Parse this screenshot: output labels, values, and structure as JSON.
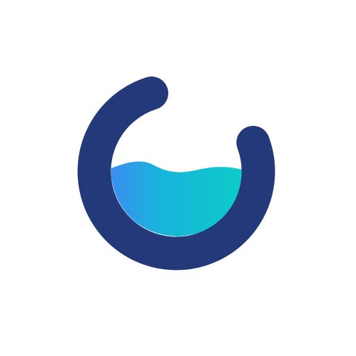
{
  "icon": {
    "name": "water-drop-ring-logo",
    "fill_level": 0.55
  },
  "colors": {
    "background": "#ffffff",
    "ring": "#24397a",
    "water_start": "#3a8ff0",
    "water_end": "#0ccdc6"
  }
}
